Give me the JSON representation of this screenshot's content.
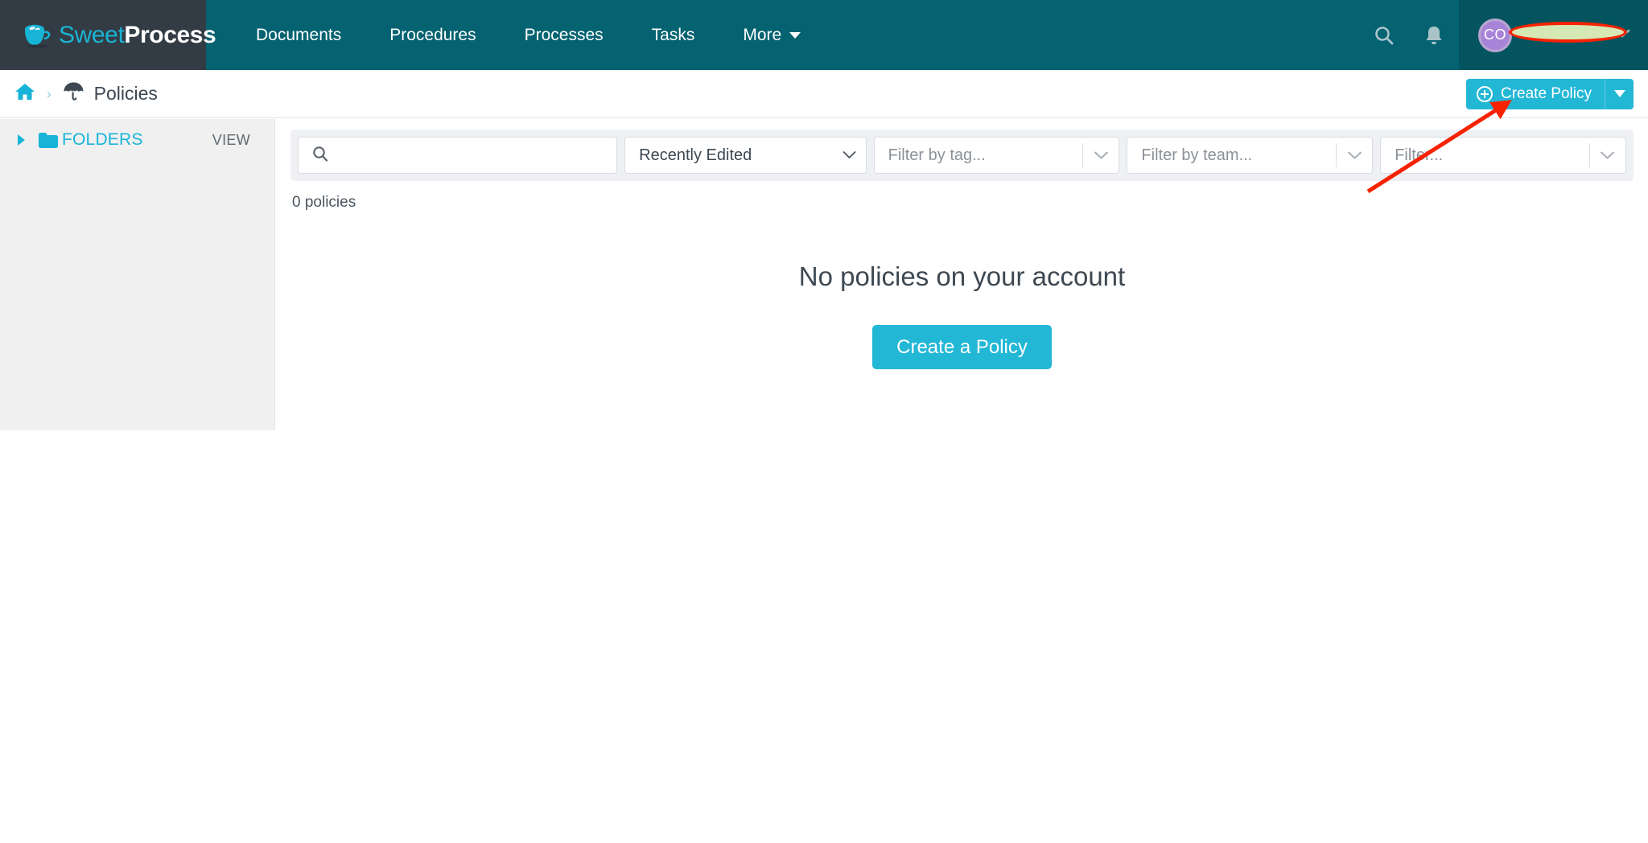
{
  "brand": {
    "name_light": "Sweet",
    "name_bold": "Process",
    "logo_icon": "coffee-cup-icon",
    "accent_cyan": "#23b7d6",
    "nav_teal": "#046271",
    "logo_block_dark": "#333c44",
    "user_block_teal": "#04545f",
    "annotation_red": "#f62200",
    "redaction_fill": "#d6e8b4"
  },
  "topnav": {
    "items": [
      {
        "label": "Documents",
        "icon": ""
      },
      {
        "label": "Procedures",
        "icon": ""
      },
      {
        "label": "Processes",
        "icon": ""
      },
      {
        "label": "Tasks",
        "icon": ""
      },
      {
        "label": "More",
        "icon": "chevron-down-icon"
      }
    ],
    "search_icon": "search-icon",
    "notifications_icon": "bell-icon",
    "user": {
      "avatar_initials": "CO",
      "name": "",
      "name_redacted": true,
      "caret_icon": "chevron-down-icon"
    }
  },
  "breadcrumb": {
    "home_icon": "home-icon",
    "separator": "›",
    "section_icon": "umbrella-icon",
    "title": "Policies"
  },
  "header_actions": {
    "create_label": "Create Policy",
    "create_icon": "plus-circle-icon",
    "dropdown_icon": "caret-down-icon"
  },
  "sidebar": {
    "chevron_icon": "chevron-right-icon",
    "folder_icon": "folder-icon",
    "folders_label": "FOLDERS",
    "view_label": "VIEW"
  },
  "filters": {
    "search": {
      "icon": "search-icon",
      "value": "",
      "placeholder": ""
    },
    "sort": {
      "value": "Recently Edited",
      "options": [
        "Recently Edited"
      ]
    },
    "tag": {
      "placeholder": "Filter by tag...",
      "chevron_icon": "chevron-down-icon"
    },
    "team": {
      "placeholder": "Filter by team...",
      "chevron_icon": "chevron-down-icon"
    },
    "other": {
      "placeholder": "Filter...",
      "chevron_icon": "chevron-down-icon"
    }
  },
  "content": {
    "count_text": "0 policies",
    "empty_title": "No policies on your account",
    "empty_button": "Create a Policy"
  }
}
